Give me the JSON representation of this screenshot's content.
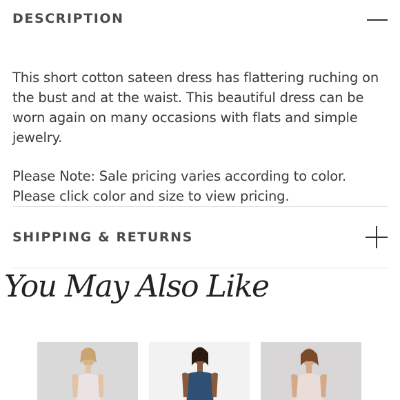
{
  "description": {
    "title": "DESCRIPTION",
    "state_icon": "minus-icon",
    "paragraph1": "This short cotton sateen dress has flattering ruching on the bust and at the waist. This beautiful dress can be worn again on many occasions with flats and simple jewelry.",
    "paragraph2": "Please Note: Sale pricing varies according to color. Please click color and size to view pricing."
  },
  "shipping": {
    "title": "SHIPPING & RETURNS",
    "state_icon": "plus-icon"
  },
  "recommendations": {
    "heading": "You May Also Like",
    "products": [
      {
        "dress_color": "#e8e0e0",
        "background": "#d9d9d9"
      },
      {
        "dress_color": "#2f4f74",
        "background": "#f2f2f2"
      },
      {
        "dress_color": "#eadcd6",
        "background": "#d8d6d6"
      }
    ]
  }
}
